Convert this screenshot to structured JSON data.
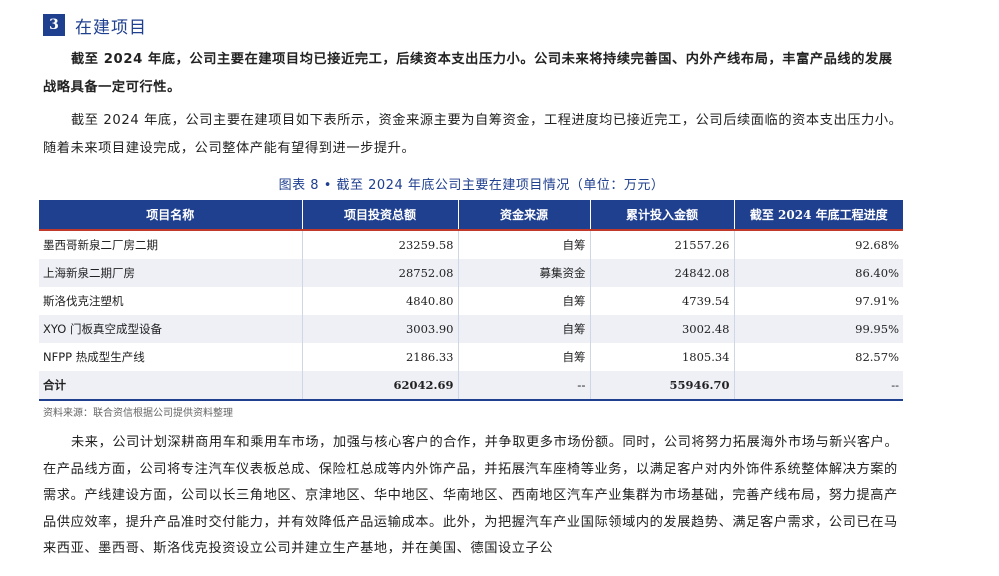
{
  "section": {
    "number": "3",
    "title": "在建项目"
  },
  "summary": "截至 2024 年底，公司主要在建项目均已接近完工，后续资本支出压力小。公司未来将持续完善国、内外产线布局，丰富产品线的发展战略具备一定可行性。",
  "intro": "截至 2024 年底，公司主要在建项目如下表所示，资金来源主要为自筹资金，工程进度均已接近完工，公司后续面临的资本支出压力小。随着未来项目建设完成，公司整体产能有望得到进一步提升。",
  "figure_caption": "图表 8 •   截至 2024 年底公司主要在建项目情况（单位：万元）",
  "table": {
    "headers": [
      "项目名称",
      "项目投资总额",
      "资金来源",
      "累计投入金额",
      "截至 2024 年底工程进度"
    ],
    "rows": [
      [
        "墨西哥新泉二厂房二期",
        "23259.58",
        "自筹",
        "21557.26",
        "92.68%"
      ],
      [
        "上海新泉二期厂房",
        "28752.08",
        "募集资金",
        "24842.08",
        "86.40%"
      ],
      [
        "斯洛伐克注塑机",
        "4840.80",
        "自筹",
        "4739.54",
        "97.91%"
      ],
      [
        "XYO 门板真空成型设备",
        "3003.90",
        "自筹",
        "3002.48",
        "99.95%"
      ],
      [
        "NFPP 热成型生产线",
        "2186.33",
        "自筹",
        "1805.34",
        "82.57%"
      ]
    ],
    "total": [
      "合计",
      "62042.69",
      "--",
      "55946.70",
      "--"
    ]
  },
  "source_note": "资料来源：联合资信根据公司提供资料整理",
  "outlook": "未来，公司计划深耕商用车和乘用车市场，加强与核心客户的合作，并争取更多市场份额。同时，公司将努力拓展海外市场与新兴客户。在产品线方面，公司将专注汽车仪表板总成、保险杠总成等内外饰产品，并拓展汽车座椅等业务，以满足客户对内外饰件系统整体解决方案的需求。产线建设方面，公司以长三角地区、京津地区、华中地区、华南地区、西南地区汽车产业集群为市场基础，完善产线布局，努力提高产品供应效率，提升产品准时交付能力，并有效降低产品运输成本。此外，为把握汽车产业国际领域内的发展趋势、满足客户需求，公司已在马来西亚、墨西哥、斯洛伐克投资设立公司并建立生产基地，并在美国、德国设立子公"
}
